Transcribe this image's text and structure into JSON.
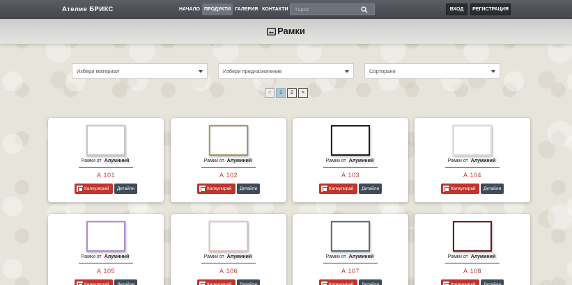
{
  "navbar": {
    "brand": "Ателие  БРИКС",
    "links": [
      "НАЧАЛО",
      "ПРОДУКТИ",
      "ГАЛЕРИЯ",
      "КОНТАКТИ"
    ],
    "active_link": "ПРОДУКТИ",
    "search_placeholder": "Търси",
    "login_label": "ВХОД",
    "register_label": "РЕГИСТРАЦИЯ"
  },
  "page": {
    "title": "Рамки",
    "title_icon": "frame-icon"
  },
  "filters": {
    "material": "Избери материал",
    "purpose": "Избери предназначение",
    "sort": "Сортиране"
  },
  "pagination": {
    "prev": "<",
    "pages": [
      "1",
      "2"
    ],
    "next": ">",
    "current": "1"
  },
  "card_text": {
    "frames_from": "Рамки от",
    "calculate": "Калкулирай",
    "details": "Детайли"
  },
  "products": [
    {
      "code": "А 101",
      "material": "Алуминий",
      "frame_color": "#c9c9c9"
    },
    {
      "code": "А 102",
      "material": "Алуминий",
      "frame_color": "#a9966a"
    },
    {
      "code": "А 103",
      "material": "Алуминий",
      "frame_color": "#1e1e1e"
    },
    {
      "code": "А 104",
      "material": "Алуминий",
      "frame_color": "#dcdcdc"
    },
    {
      "code": "А 105",
      "material": "Алуминий",
      "frame_color": "#b48fd6"
    },
    {
      "code": "А 106",
      "material": "Алуминий",
      "frame_color": "#e9c2c2"
    },
    {
      "code": "А 107",
      "material": "Алуминий",
      "frame_color": "#5f6f82"
    },
    {
      "code": "А 108",
      "material": "Алуминий",
      "frame_color": "#6b1a1e"
    }
  ]
}
